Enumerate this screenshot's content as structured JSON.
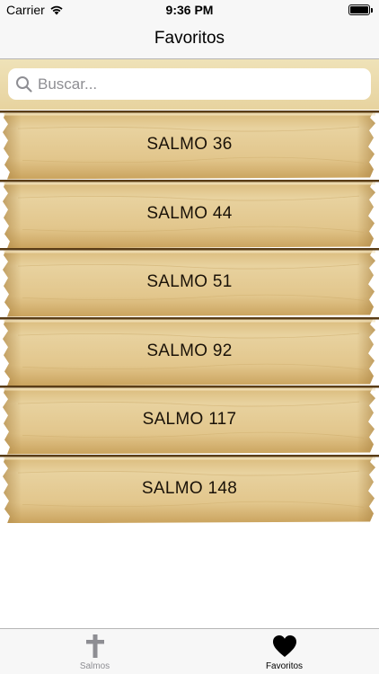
{
  "status_bar": {
    "carrier": "Carrier",
    "time": "9:36 PM"
  },
  "nav_bar": {
    "title": "Favoritos"
  },
  "search": {
    "placeholder": "Buscar..."
  },
  "psalms": [
    "SALMO 36",
    "SALMO 44",
    "SALMO 51",
    "SALMO 92",
    "SALMO 117",
    "SALMO 148"
  ],
  "tab_bar": {
    "tabs": [
      {
        "label": "Salmos",
        "icon": "cross-icon",
        "active": false
      },
      {
        "label": "Favoritos",
        "icon": "heart-icon",
        "active": true
      }
    ]
  },
  "colors": {
    "parchment_light": "#e9d6a6",
    "parchment_dark": "#cfa863",
    "tab_inactive": "#8e8e93"
  }
}
